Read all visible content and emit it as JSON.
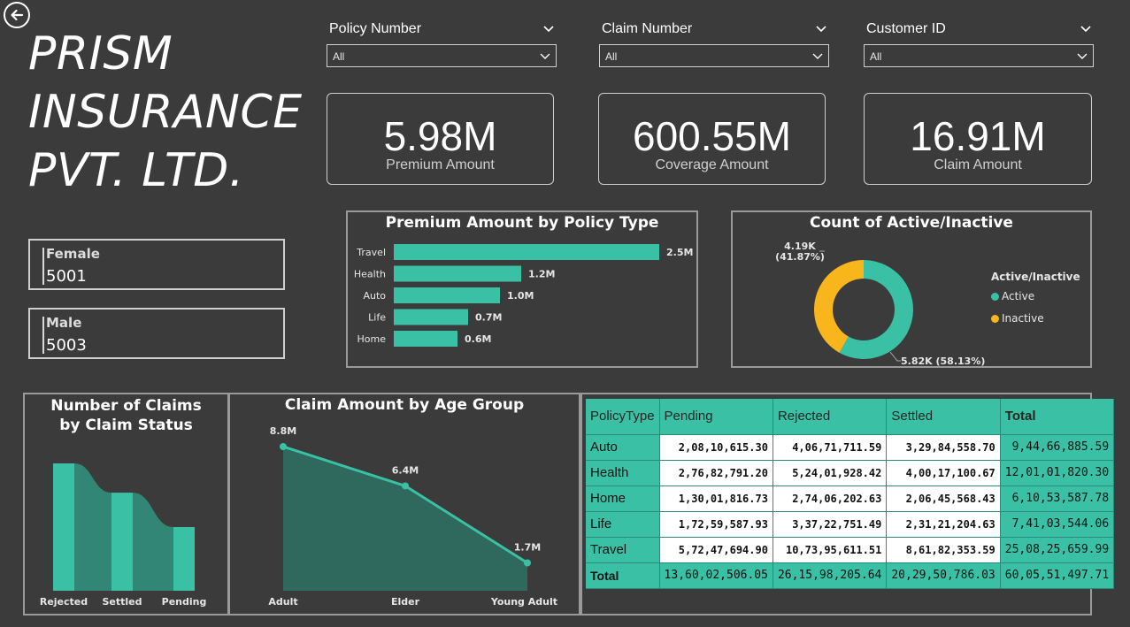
{
  "header": {
    "title_lines": [
      "PRISM",
      "INSURANCE",
      "PVT. LTD."
    ]
  },
  "filters": [
    {
      "label": "Policy Number",
      "value": "All"
    },
    {
      "label": "Claim Number",
      "value": "All"
    },
    {
      "label": "Customer ID",
      "value": "All"
    }
  ],
  "kpis": [
    {
      "value": "5.98M",
      "label": "Premium Amount"
    },
    {
      "value": "600.55M",
      "label": "Coverage Amount"
    },
    {
      "value": "16.91M",
      "label": "Claim Amount"
    }
  ],
  "gender": [
    {
      "label": "Female",
      "value": "5001"
    },
    {
      "label": "Male",
      "value": "5003"
    }
  ],
  "colors": {
    "teal": "#3ac0a4",
    "amber": "#f9b51c",
    "background": "#3b3b3b"
  },
  "chart_data": [
    {
      "type": "bar",
      "orientation": "horizontal",
      "title": "Premium Amount by Policy Type",
      "categories": [
        "Travel",
        "Health",
        "Auto",
        "Life",
        "Home"
      ],
      "values": [
        2.5,
        1.2,
        1.0,
        0.7,
        0.6
      ],
      "value_labels": [
        "2.5M",
        "1.2M",
        "1.0M",
        "0.7M",
        "0.6M"
      ],
      "unit": "M",
      "xlim": [
        0,
        2.5
      ]
    },
    {
      "type": "pie",
      "variant": "donut",
      "title": "Count of Active/Inactive",
      "legend_title": "Active/Inactive",
      "legend_placement": "right",
      "categories": [
        "Active",
        "Inactive"
      ],
      "values": [
        5820,
        4190
      ],
      "percents": [
        58.13,
        41.87
      ],
      "labels": [
        "5.82K (58.13%)",
        "4.19K (41.87%)"
      ],
      "colors": [
        "#3ac0a4",
        "#f9b51c"
      ]
    },
    {
      "type": "bar",
      "variant": "ribbon",
      "title": "Number of Claims by Claim Status",
      "categories": [
        "Rejected",
        "Settled",
        "Pending"
      ],
      "values": [
        1.0,
        0.77,
        0.5
      ],
      "value_scale": "relative"
    },
    {
      "type": "area",
      "title": "Claim Amount by Age Group",
      "categories": [
        "Adult",
        "Elder",
        "Young Adult"
      ],
      "values": [
        8.8,
        6.4,
        1.7
      ],
      "value_labels": [
        "8.8M",
        "6.4M",
        "1.7M"
      ],
      "unit": "M",
      "ylim": [
        0,
        8.8
      ]
    },
    {
      "type": "table",
      "row_header": "PolicyType",
      "columns": [
        "Pending",
        "Rejected",
        "Settled",
        "Total"
      ],
      "rows": [
        {
          "name": "Auto",
          "values": [
            "2,08,10,615.30",
            "4,06,71,711.59",
            "3,29,84,558.70",
            "9,44,66,885.59"
          ]
        },
        {
          "name": "Health",
          "values": [
            "2,76,82,791.20",
            "5,24,01,928.42",
            "4,00,17,100.67",
            "12,01,01,820.30"
          ]
        },
        {
          "name": "Home",
          "values": [
            "1,30,01,816.73",
            "2,74,06,202.63",
            "2,06,45,568.43",
            "6,10,53,587.78"
          ]
        },
        {
          "name": "Life",
          "values": [
            "1,72,59,587.93",
            "3,37,22,751.49",
            "2,31,21,204.63",
            "7,41,03,544.06"
          ]
        },
        {
          "name": "Travel",
          "values": [
            "5,72,47,694.90",
            "10,73,95,611.51",
            "8,61,82,353.59",
            "25,08,25,659.99"
          ]
        }
      ],
      "total_row": {
        "name": "Total",
        "values": [
          "13,60,02,506.05",
          "26,15,98,205.64",
          "20,29,50,786.03",
          "60,05,51,497.71"
        ]
      }
    }
  ]
}
